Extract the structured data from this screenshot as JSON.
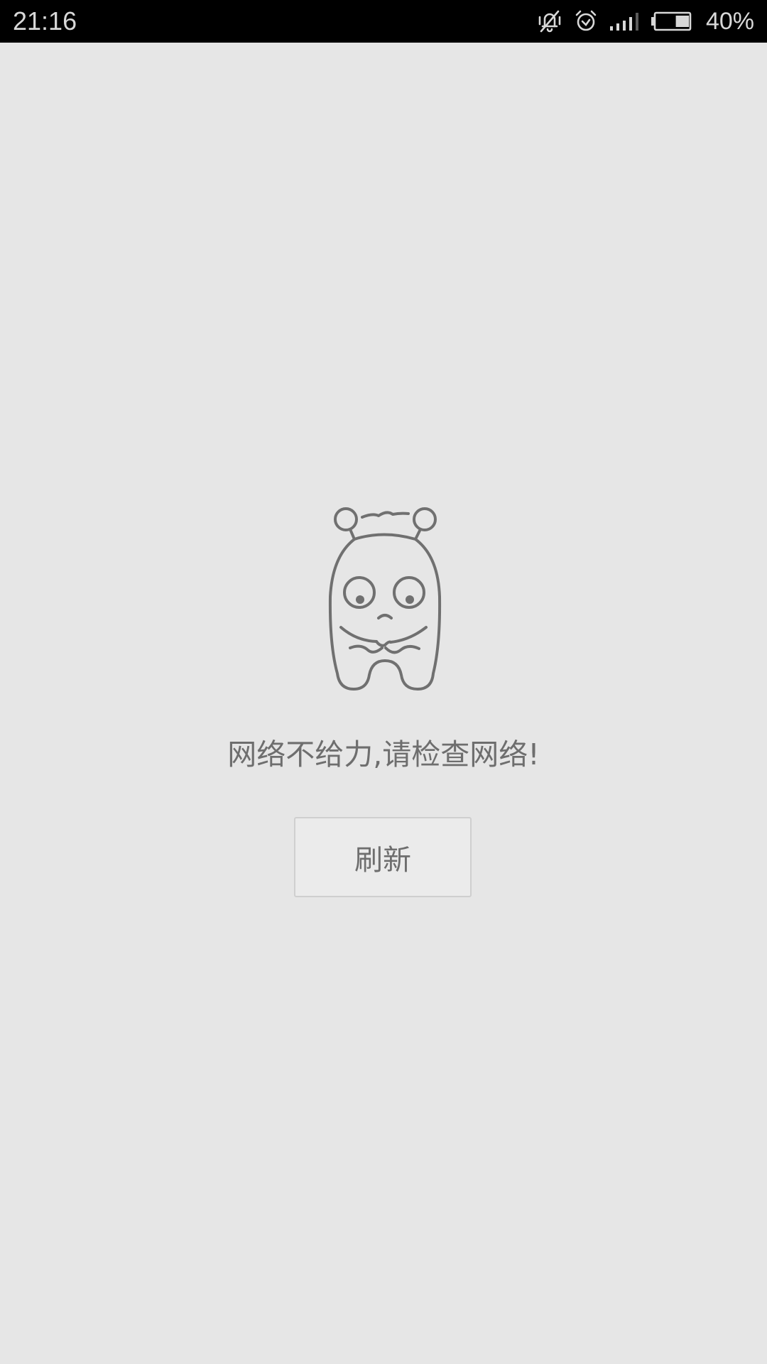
{
  "status_bar": {
    "time": "21:16",
    "battery_percent": "40%",
    "battery_level": 0.4,
    "icons": [
      "vibrate-off-icon",
      "alarm-icon",
      "signal-icon",
      "battery-icon"
    ]
  },
  "empty_state": {
    "illustration": "sad-monster-icon",
    "message": "网络不给力,请检查网络!",
    "refresh_label": "刷新"
  },
  "colors": {
    "background": "#e6e6e6",
    "status_bar": "#000000",
    "text": "#6e6e6e",
    "illustration_stroke": "#707070",
    "button_border": "#cfcfcf"
  }
}
